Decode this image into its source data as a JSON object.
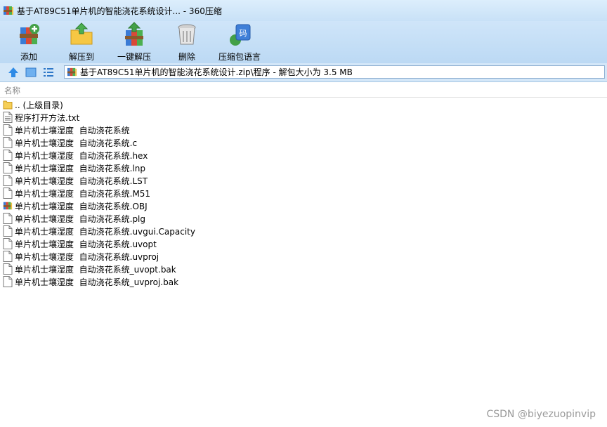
{
  "window": {
    "title": "基于AT89C51单片机的智能浇花系统设计... - 360压缩",
    "app_icon": "winrar-books-icon"
  },
  "toolbar": {
    "items": [
      {
        "label": "添加",
        "icon": "add-archive-icon"
      },
      {
        "label": "解压到",
        "icon": "extract-folder-icon"
      },
      {
        "label": "一键解压",
        "icon": "one-click-extract-icon"
      },
      {
        "label": "删除",
        "icon": "delete-bin-icon"
      },
      {
        "label": "压缩包语言",
        "icon": "archive-language-icon"
      }
    ]
  },
  "address_bar": {
    "nav_icons": [
      "up-arrow-icon",
      "view-large-icon",
      "view-list-icon"
    ],
    "path": "基于AT89C51单片机的智能浇花系统设计.zip\\程序 - 解包大小为 3.5 MB"
  },
  "file_list": {
    "column_name": "名称",
    "items": [
      {
        "name": ".. (上级目录)",
        "icon": "folder-icon"
      },
      {
        "name": "程序打开方法.txt",
        "icon": "text-file-icon"
      },
      {
        "name": "单片机士壤湿度  自动浇花系统",
        "icon": "file-icon"
      },
      {
        "name": "单片机士壤湿度  自动浇花系统.c",
        "icon": "file-icon"
      },
      {
        "name": "单片机士壤湿度  自动浇花系统.hex",
        "icon": "file-icon"
      },
      {
        "name": "单片机士壤湿度  自动浇花系统.lnp",
        "icon": "file-icon"
      },
      {
        "name": "单片机士壤湿度  自动浇花系统.LST",
        "icon": "file-icon"
      },
      {
        "name": "单片机士壤湿度  自动浇花系统.M51",
        "icon": "file-icon"
      },
      {
        "name": "单片机士壤湿度  自动浇花系统.OBJ",
        "icon": "archive-file-icon"
      },
      {
        "name": "单片机士壤湿度  自动浇花系统.plg",
        "icon": "file-icon"
      },
      {
        "name": "单片机士壤湿度  自动浇花系统.uvgui.Capacity",
        "icon": "file-icon"
      },
      {
        "name": "单片机士壤湿度  自动浇花系统.uvopt",
        "icon": "file-icon"
      },
      {
        "name": "单片机士壤湿度  自动浇花系统.uvproj",
        "icon": "file-icon"
      },
      {
        "name": "单片机士壤湿度  自动浇花系统_uvopt.bak",
        "icon": "file-icon"
      },
      {
        "name": "单片机士壤湿度  自动浇花系统_uvproj.bak",
        "icon": "file-icon"
      }
    ]
  },
  "watermark": "CSDN @biyezuopinvip",
  "colors": {
    "toolbar_bg": "#c8e1f7",
    "address_border": "#8fb0d2"
  }
}
